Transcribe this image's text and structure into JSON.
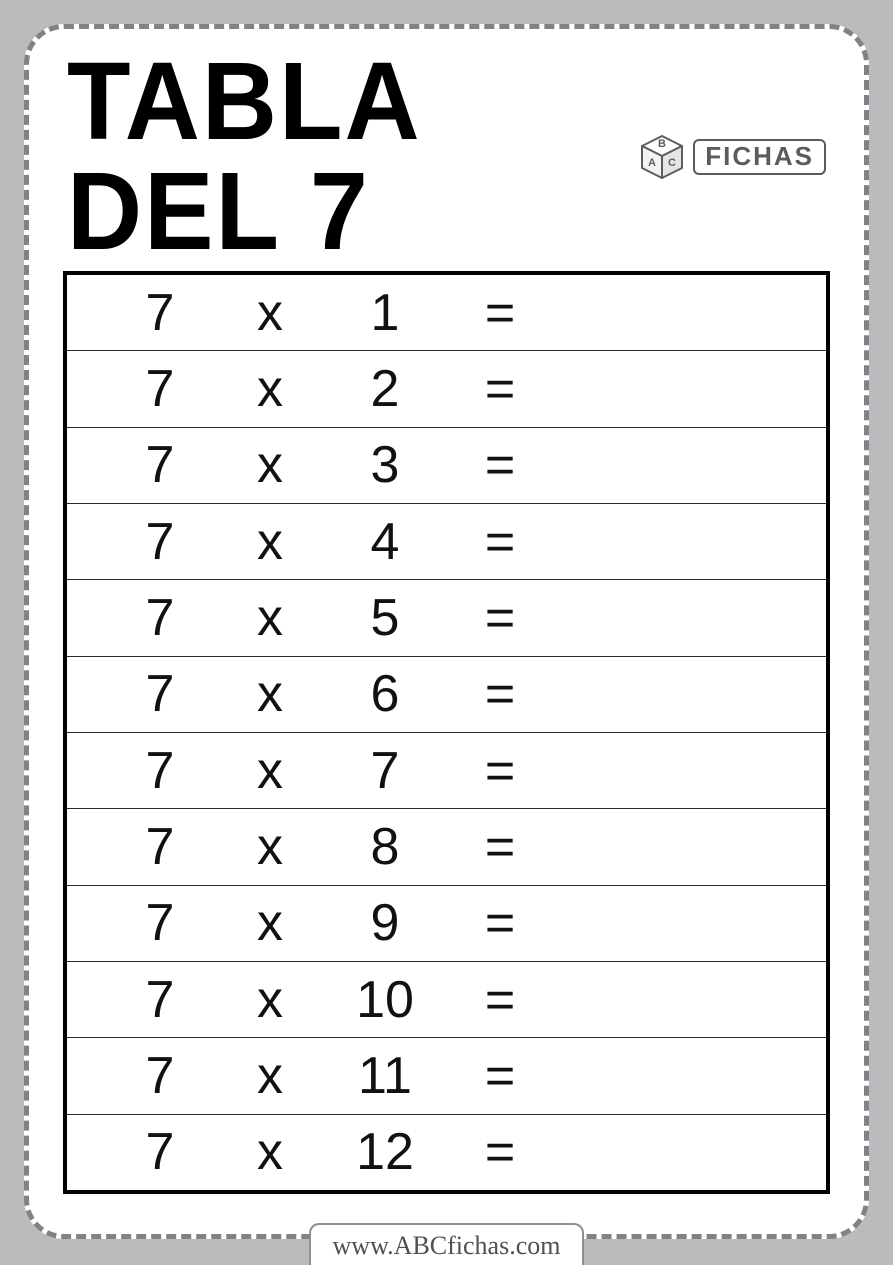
{
  "header": {
    "title": "TABLA DEL 7",
    "logo_text": "FICHAS"
  },
  "symbols": {
    "times": "x",
    "equals": "="
  },
  "table": {
    "multiplicand": "7",
    "rows": [
      {
        "b": "1"
      },
      {
        "b": "2"
      },
      {
        "b": "3"
      },
      {
        "b": "4"
      },
      {
        "b": "5"
      },
      {
        "b": "6"
      },
      {
        "b": "7"
      },
      {
        "b": "8"
      },
      {
        "b": "9"
      },
      {
        "b": "10"
      },
      {
        "b": "11"
      },
      {
        "b": "12"
      }
    ]
  },
  "footer": {
    "url": "www.ABCfichas.com"
  }
}
